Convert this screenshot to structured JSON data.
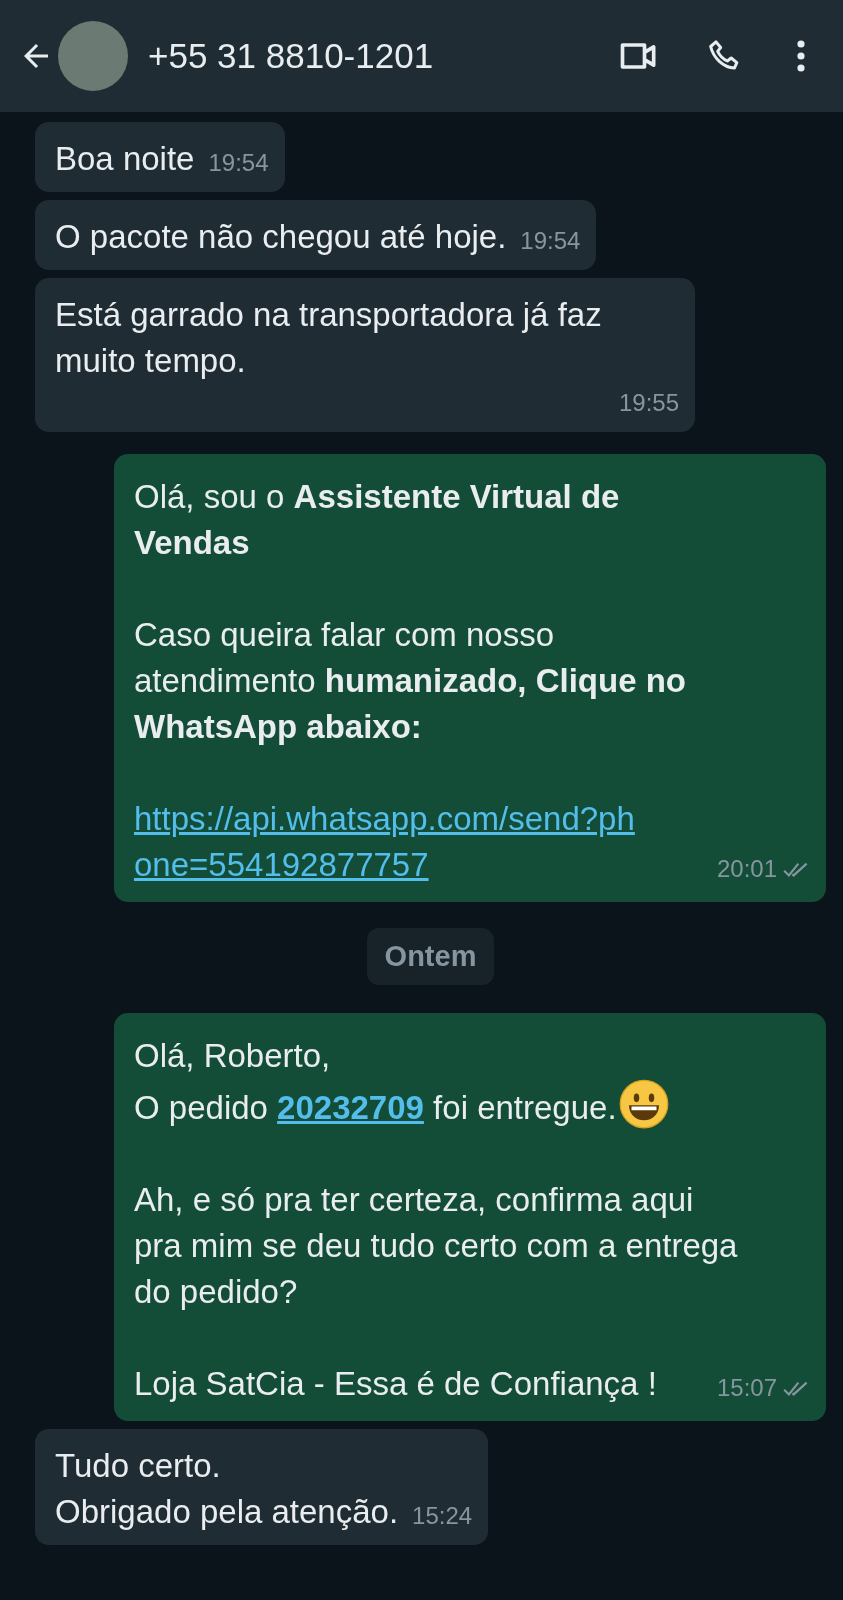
{
  "header": {
    "title": "+55 31 8810-1201"
  },
  "messages": [
    {
      "kind": "incoming",
      "time": "19:54",
      "paragraphs": [
        {
          "lines": [
            {
              "segments": [
                {
                  "kind": "text",
                  "text": "Boa noite"
                }
              ]
            }
          ]
        }
      ]
    },
    {
      "kind": "incoming",
      "time": "19:54",
      "paragraphs": [
        {
          "lines": [
            {
              "segments": [
                {
                  "kind": "text",
                  "text": "O pacote não chegou até hoje."
                }
              ]
            }
          ]
        }
      ]
    },
    {
      "kind": "incoming",
      "time": "19:55",
      "paragraphs": [
        {
          "lines": [
            {
              "segments": [
                {
                  "kind": "text",
                  "text": "Está garrado na transportadora já faz muito tempo."
                }
              ]
            }
          ]
        }
      ]
    },
    {
      "kind": "outgoing",
      "time": "20:01",
      "read": false,
      "paragraphs": [
        {
          "lines": [
            {
              "segments": [
                {
                  "kind": "text",
                  "text": "Olá, sou o **Assistente Virtual de Vendas**"
                }
              ]
            }
          ]
        },
        {
          "lines": [
            {
              "segments": [
                {
                  "kind": "text",
                  "text": "Caso queira falar com nosso atendimento **humanizado, Clique no WhatsApp abaixo:**"
                }
              ]
            }
          ]
        },
        {
          "lines": [
            {
              "segments": [
                {
                  "kind": "url",
                  "text": "https://api.whatsapp.com/send?phone=554192877757"
                }
              ]
            }
          ]
        }
      ]
    },
    {
      "kind": "date",
      "text": "Ontem"
    },
    {
      "kind": "outgoing",
      "time": "15:07",
      "read": false,
      "paragraphs": [
        {
          "lines": [
            {
              "segments": [
                {
                  "kind": "text",
                  "text": "Olá, Roberto,"
                }
              ]
            },
            {
              "segments": [
                {
                  "kind": "text",
                  "text": "O pedido "
                },
                {
                  "kind": "link",
                  "text": "20232709"
                },
                {
                  "kind": "text",
                  "text": " foi entregue."
                },
                {
                  "kind": "emoji"
                }
              ]
            }
          ]
        },
        {
          "lines": [
            {
              "segments": [
                {
                  "kind": "text",
                  "text": "Ah, e só pra ter certeza, confirma aqui pra mim se deu tudo certo com a entrega do pedido?"
                }
              ]
            }
          ]
        },
        {
          "lines": [
            {
              "segments": [
                {
                  "kind": "text",
                  "text": "Loja SatCia - Essa é de Confiança !"
                }
              ]
            }
          ]
        }
      ]
    },
    {
      "kind": "incoming",
      "time": "15:24",
      "paragraphs": [
        {
          "lines": [
            {
              "segments": [
                {
                  "kind": "text",
                  "text": "Tudo certo.\nObrigado pela atenção."
                }
              ]
            }
          ]
        }
      ]
    }
  ]
}
